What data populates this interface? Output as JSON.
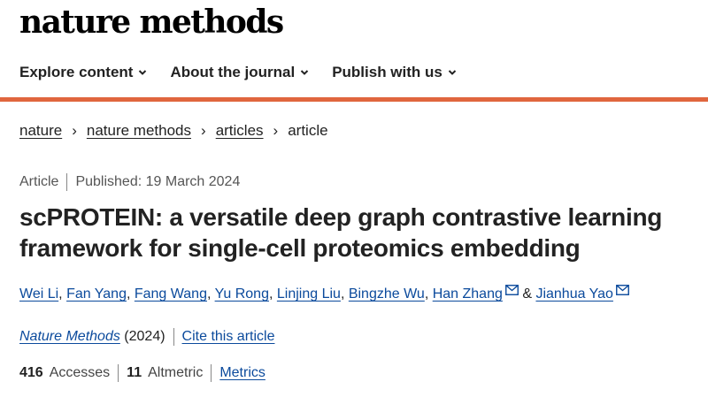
{
  "site": {
    "logo": "nature methods"
  },
  "nav": {
    "items": [
      {
        "label": "Explore content"
      },
      {
        "label": "About the journal"
      },
      {
        "label": "Publish with us"
      }
    ]
  },
  "breadcrumb": {
    "items": [
      {
        "label": "nature"
      },
      {
        "label": "nature methods"
      },
      {
        "label": "articles"
      }
    ],
    "current": "article"
  },
  "article": {
    "type": "Article",
    "published": "Published: 19 March 2024",
    "title": "scPROTEIN: a versatile deep graph contrastive learning framework for single-cell proteomics embedding",
    "authors": [
      {
        "name": "Wei Li"
      },
      {
        "name": "Fan Yang"
      },
      {
        "name": "Fang Wang"
      },
      {
        "name": "Yu Rong"
      },
      {
        "name": "Linjing Liu"
      },
      {
        "name": "Bingzhe Wu"
      },
      {
        "name": "Han Zhang",
        "contact": true
      },
      {
        "name": "Jianhua Yao",
        "contact": true
      }
    ],
    "journal": "Nature Methods",
    "year": "(2024)",
    "cite_label": "Cite this article",
    "accesses_count": "416",
    "accesses_label": "Accesses",
    "altmetric_count": "11",
    "altmetric_label": "Altmetric",
    "metrics_label": "Metrics"
  },
  "colors": {
    "accent": "#e0663e",
    "link": "#0b4a9c"
  }
}
